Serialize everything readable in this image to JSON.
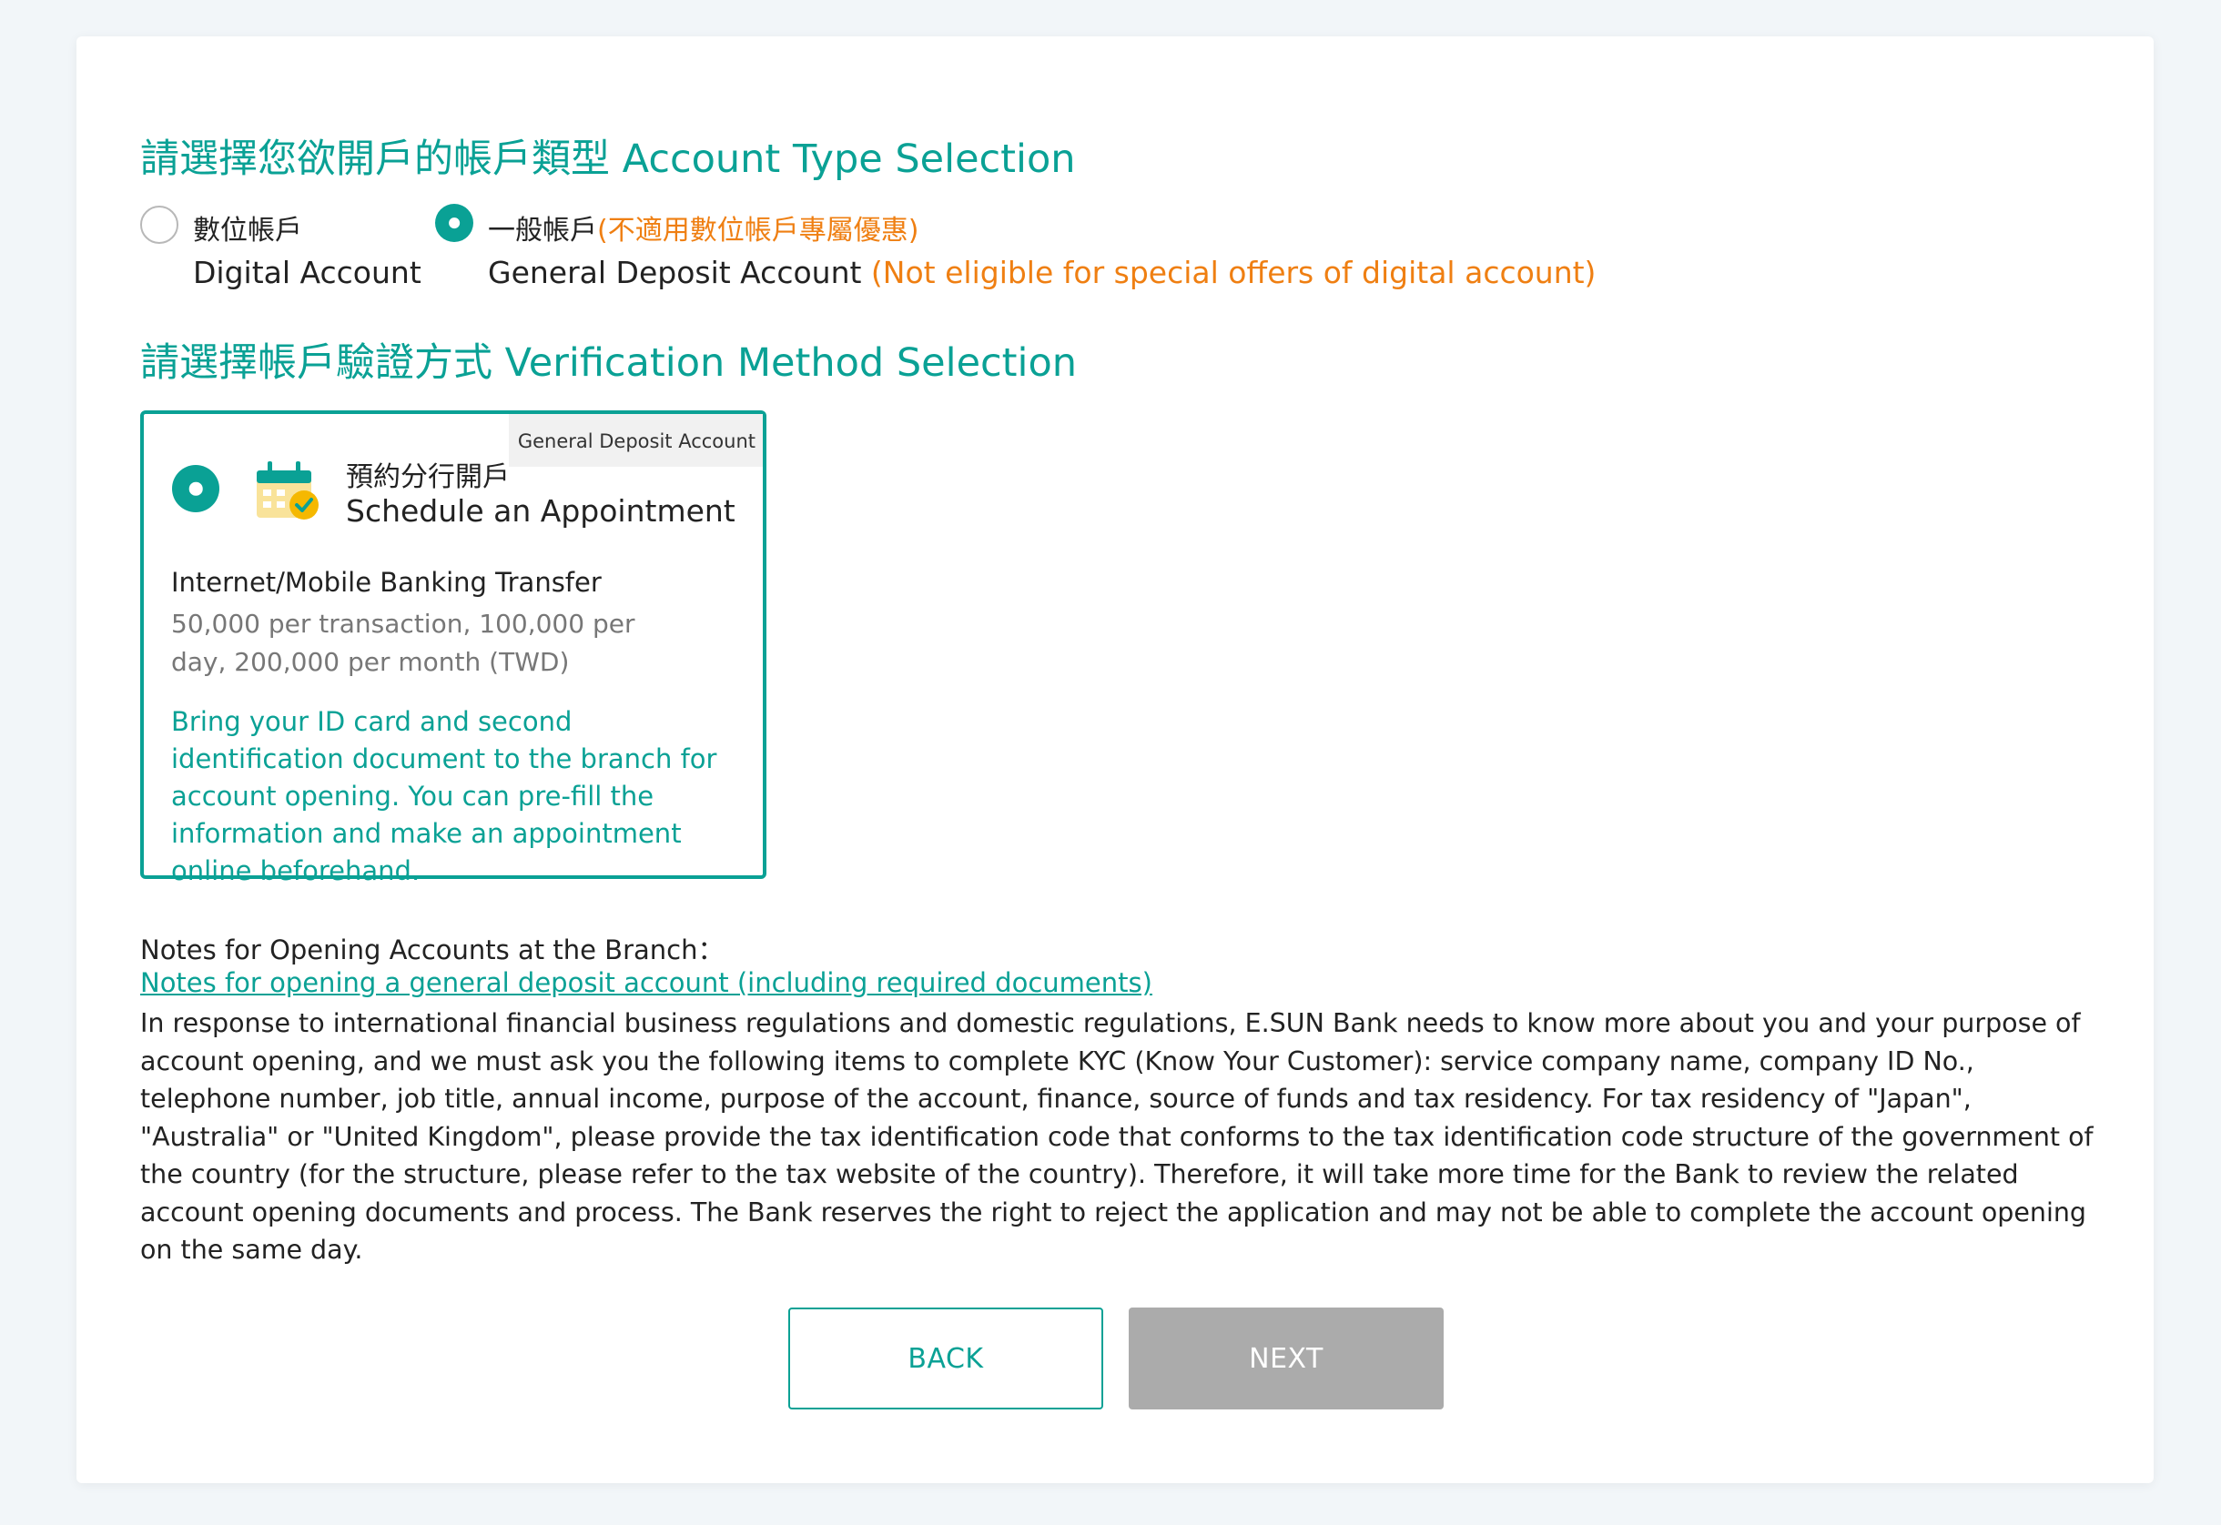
{
  "account_type": {
    "title": "請選擇您欲開戶的帳戶類型 Account Type Selection",
    "options": [
      {
        "zh": "數位帳戶",
        "en": "Digital Account",
        "selected": false
      },
      {
        "zh": "一般帳戶",
        "zh_note": "(不適用數位帳戶專屬優惠)",
        "en": "General Deposit Account",
        "en_note": "(Not eligible for special offers of digital account)",
        "selected": true
      }
    ]
  },
  "verification": {
    "title": "請選擇帳戶驗證方式 Verification Method Selection",
    "card": {
      "tag": "General Deposit Account",
      "icon": "calendar-check-icon",
      "zh": "預約分行開戶",
      "en": "Schedule an Appointment",
      "limit_title": "Internet/Mobile Banking Transfer",
      "limit_desc": "50,000 per transaction, 100,000 per day, 200,000 per month (TWD)",
      "note": "Bring your ID card and second identification document to the branch for account opening. You can pre-fill the information and make an appointment online beforehand.",
      "selected": true
    }
  },
  "notes": {
    "title": "Notes for Opening Accounts at the Branch：",
    "link": "Notes for opening a general deposit account (including required documents)",
    "body": "In response to international financial business regulations and domestic regulations, E.SUN Bank needs to know more about you and your purpose of account opening, and we must ask you the following items to complete KYC (Know Your Customer): service company name, company ID No., telephone number, job title, annual income, purpose of the account, finance, source of funds and tax residency. For tax residency of \"Japan\", \"Australia\" or \"United Kingdom\", please provide the tax identification code that conforms to the tax identification code structure of the government of the country (for the structure, please refer to the tax website of the country). Therefore, it will take more time for the Bank to review the related account opening documents and process. The Bank reserves the right to reject the application and may not be able to complete the account opening on the same day."
  },
  "buttons": {
    "back": "BACK",
    "next": "NEXT"
  },
  "colors": {
    "accent": "#0aa195",
    "warning": "#ef7f12",
    "disabled": "#ababab"
  }
}
